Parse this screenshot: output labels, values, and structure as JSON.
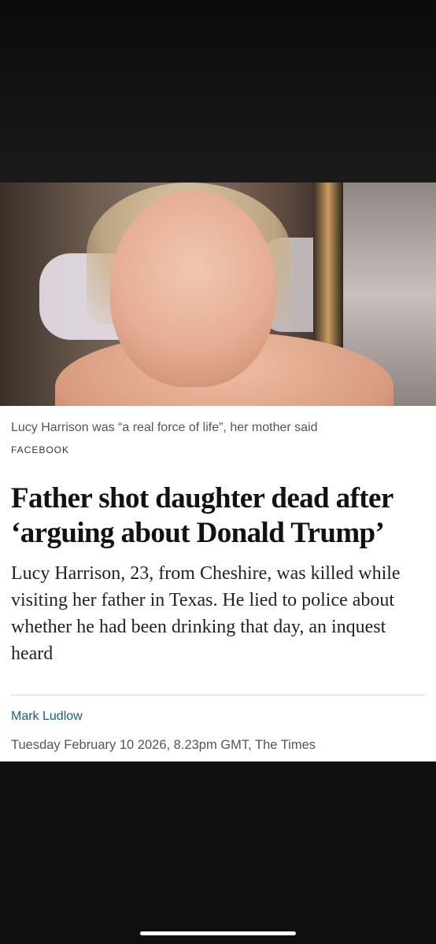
{
  "article": {
    "image_caption": "Lucy Harrison was “a real force of life”, her mother said",
    "image_credit": "FACEBOOK",
    "headline": "Father shot daughter dead after ‘arguing about Donald Trump’",
    "standfirst": "Lucy Harrison, 23, from Cheshire, was killed while visiting her father in Texas. He lied to police about whether he had been drinking that day, an inquest heard",
    "author": "Mark Ludlow",
    "dateline": "Tuesday February 10 2026, 8.23pm GMT, The Times"
  },
  "colors": {
    "background": "#0f0f0f",
    "card": "#ffffff",
    "author_link": "#1a5d8f"
  }
}
